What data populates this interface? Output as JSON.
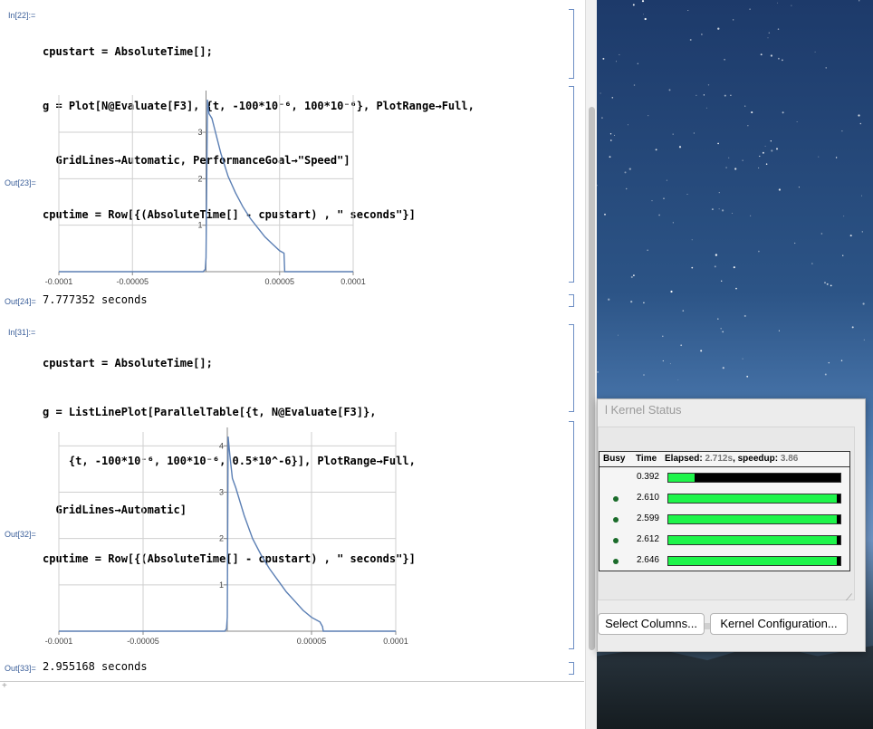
{
  "notebook": {
    "cell1": {
      "in_label": "In[22]:=",
      "lines": [
        "cpustart = AbsoluteTime[];",
        "g = Plot[N@Evaluate[F3], {t, -100*10⁻⁶, 100*10⁻⁶}, PlotRange→Full,",
        "  GridLines→Automatic, PerformanceGoal→\"Speed\"]",
        "cputime = Row[{(AbsoluteTime[] - cpustart) , \" seconds\"}]"
      ],
      "out_plot_label": "Out[23]=",
      "out_time_label": "Out[24]=",
      "out_time": "7.777352 seconds"
    },
    "cell2": {
      "in_label": "In[31]:=",
      "lines": [
        "cpustart = AbsoluteTime[];",
        "g = ListLinePlot[ParallelTable[{t, N@Evaluate[F3]},",
        "    {t, -100*10⁻⁶, 100*10⁻⁶, 0.5*10^-6}], PlotRange→Full,",
        "  GridLines→Automatic]",
        "cputime = Row[{(AbsoluteTime[] - cpustart) , \" seconds\"}]"
      ],
      "out_plot_label": "Out[32]=",
      "out_time_label": "Out[33]=",
      "out_time": "2.955168 seconds"
    }
  },
  "chart_data": [
    {
      "type": "line",
      "title": "",
      "xlabel": "",
      "ylabel": "",
      "xlim": [
        -0.0001,
        0.0001
      ],
      "ylim": [
        0,
        3.8
      ],
      "x_ticks": [
        "-0.0001",
        "-0.00005",
        "0.00005",
        "0.0001"
      ],
      "y_ticks": [
        "1",
        "2",
        "3"
      ],
      "grid": true,
      "series": [
        {
          "color": "#5b7fb4",
          "x": [
            -0.0001,
            -1e-05,
            -2e-06,
            -5e-07,
            0,
            1e-06,
            2e-06,
            4e-06,
            6e-06,
            1e-05,
            1.5e-05,
            2e-05,
            2.5e-05,
            3e-05,
            3.5e-05,
            4e-05,
            4.5e-05,
            5e-05,
            5.3e-05,
            5.35e-05,
            0.0001
          ],
          "y": [
            0,
            0,
            0,
            0.05,
            0.3,
            3.7,
            3.4,
            3.3,
            3.05,
            2.55,
            2.05,
            1.7,
            1.4,
            1.15,
            0.95,
            0.75,
            0.6,
            0.45,
            0.4,
            0,
            0
          ]
        }
      ]
    },
    {
      "type": "line",
      "title": "",
      "xlabel": "",
      "ylabel": "",
      "xlim": [
        -0.0001,
        0.0001
      ],
      "ylim": [
        0,
        4.3
      ],
      "x_ticks": [
        "-0.0001",
        "-0.00005",
        "0.00005",
        "0.0001"
      ],
      "y_ticks": [
        "1",
        "2",
        "3",
        "4"
      ],
      "grid": true,
      "series": [
        {
          "color": "#5b7fb4",
          "x": [
            -0.0001,
            -5e-06,
            -1.5e-06,
            -5e-07,
            0,
            5e-07,
            1.5e-06,
            3e-06,
            5e-06,
            1e-05,
            1.5e-05,
            2e-05,
            2.5e-05,
            3e-05,
            3.5e-05,
            4e-05,
            4.5e-05,
            5e-05,
            5.5e-05,
            5.65e-05,
            5.7e-05,
            0.0001
          ],
          "y": [
            0,
            0,
            0,
            0.05,
            0.3,
            4.2,
            3.8,
            3.3,
            3.1,
            2.5,
            2.0,
            1.65,
            1.35,
            1.1,
            0.85,
            0.65,
            0.45,
            0.3,
            0.2,
            0.1,
            0,
            0
          ]
        }
      ]
    }
  ],
  "kernel_status": {
    "title": "l Kernel Status",
    "header": {
      "busy": "Busy",
      "time": "Time",
      "elapsed_label": "Elapsed:",
      "elapsed": "2.712s",
      "speedup_label": ", speedup:",
      "speedup": "3.86"
    },
    "rows": [
      {
        "busy": false,
        "time": "0.392",
        "progress": 0.15
      },
      {
        "busy": true,
        "time": "2.610",
        "progress": 0.98
      },
      {
        "busy": true,
        "time": "2.599",
        "progress": 0.98
      },
      {
        "busy": true,
        "time": "2.612",
        "progress": 0.98
      },
      {
        "busy": true,
        "time": "2.646",
        "progress": 0.98
      }
    ],
    "buttons": {
      "select_columns": "Select Columns...",
      "kernel_config": "Kernel Configuration..."
    }
  },
  "colors": {
    "label": "#3b5f9a",
    "plot_line": "#5b7fb4",
    "progress": "#1ef54a"
  }
}
